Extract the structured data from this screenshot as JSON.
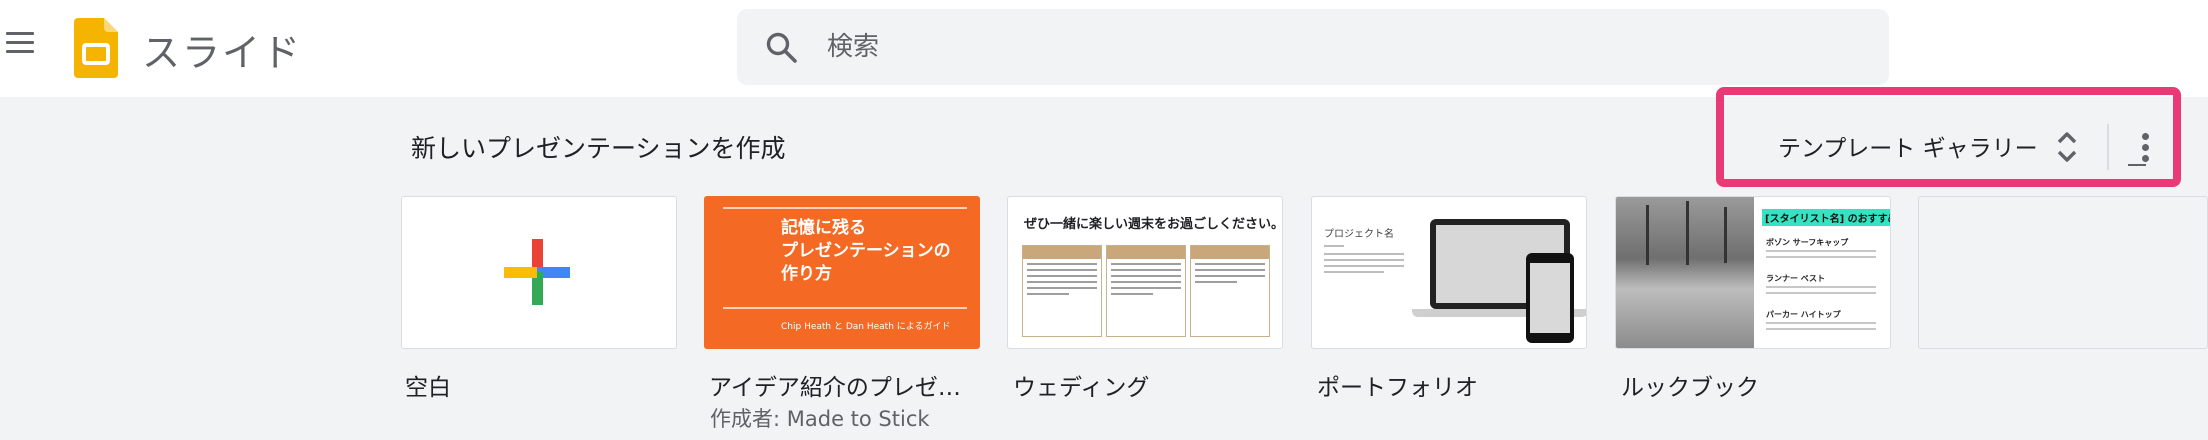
{
  "header": {
    "app_title": "スライド",
    "search": {
      "placeholder": "検索",
      "value": ""
    }
  },
  "templates": {
    "section_title": "新しいプレゼンテーションを作成",
    "gallery_label": "テンプレート ギャラリー",
    "items": [
      {
        "label": "空白",
        "sub": ""
      },
      {
        "label": "アイデア紹介のプレゼ…",
        "sub": "作成者: Made to Stick"
      },
      {
        "label": "ウェディング",
        "sub": ""
      },
      {
        "label": "ポートフォリオ",
        "sub": ""
      },
      {
        "label": "ルックブック",
        "sub": ""
      }
    ],
    "idea_thumb": {
      "title": "記憶に残る\nプレゼンテーションの\n作り方",
      "subtitle": "Chip Heath と Dan Heath によるガイド"
    },
    "wedding_thumb": {
      "title": "ぜひ一緒に楽しい週末をお過ごしください。"
    },
    "portfolio_thumb": {
      "title": "プロジェクト名"
    },
    "lookbook_thumb": {
      "tag": "[スタイリスト名] のおすすめ",
      "items": [
        "ボゾン サーフキャップ",
        "ランナー ベスト",
        "パーカー ハイトップ"
      ]
    }
  },
  "colors": {
    "highlight": "#ea3a75",
    "slides_yellow": "#f4b400",
    "idea_orange": "#f46a24",
    "section_bg": "#f1f3f4"
  },
  "icons": [
    "menu-icon",
    "slides-logo-icon",
    "search-icon",
    "unfold-icon",
    "more-vert-icon",
    "plus-icon"
  ]
}
